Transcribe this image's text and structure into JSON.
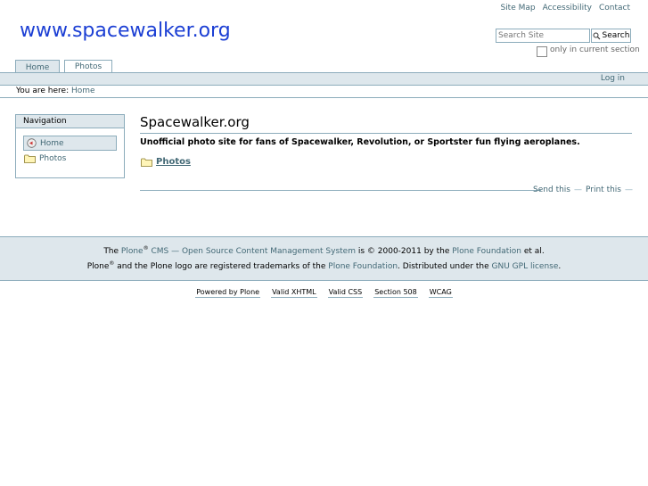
{
  "site_actions": [
    "Site Map",
    "Accessibility",
    "Contact"
  ],
  "logo": "www.spacewalker.org",
  "search": {
    "placeholder": "Search Site",
    "button_label": "Search",
    "checkbox_label": "only in current section"
  },
  "tabs": [
    {
      "label": "Home",
      "selected": true
    },
    {
      "label": "Photos",
      "selected": false
    }
  ],
  "personal_bar": {
    "login": "Log in"
  },
  "breadcrumb": {
    "prefix": "You are here:",
    "current": "Home"
  },
  "portlet": {
    "title": "Navigation",
    "items": [
      {
        "label": "Home",
        "icon": "home-icon",
        "selected": true
      },
      {
        "label": "Photos",
        "icon": "folder-icon",
        "selected": false
      }
    ]
  },
  "main": {
    "title": "Spacewalker.org",
    "description": "Unofficial photo site for fans of Spacewalker, Revolution, or Sportster fun flying aeroplanes.",
    "folder": "Photos",
    "actions": [
      "Send this",
      "Print this"
    ]
  },
  "footer": {
    "line1": {
      "t1": "The ",
      "plone": "Plone",
      "cms": " CMS — Open Source Content Management System",
      "t2": " is © 2000-2011 by the ",
      "foundation": "Plone Foundation",
      "t3": " et al."
    },
    "line2": {
      "plone": "Plone",
      "t1": " and the Plone logo are registered trademarks of the ",
      "foundation": "Plone Foundation",
      "t2": ". Distributed under the ",
      "license": "GNU GPL license",
      "t3": "."
    },
    "registered_mark": "®"
  },
  "colophon": [
    "Powered by Plone",
    "Valid XHTML",
    "Valid CSS",
    "Section 508",
    "WCAG"
  ],
  "colors": {
    "link": "#436976",
    "bar": "#dee7ec",
    "border": "#8cacbb",
    "logo": "#1c3fd4"
  }
}
